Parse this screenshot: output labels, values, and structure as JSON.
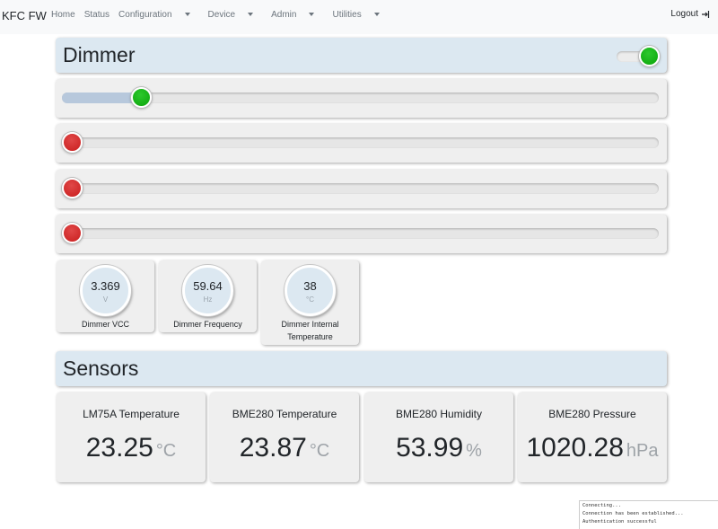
{
  "navbar": {
    "brand": "KFC FW",
    "links": [
      {
        "label": "Home"
      },
      {
        "label": "Status"
      },
      {
        "label": "Configuration"
      },
      {
        "label": "Device"
      },
      {
        "label": "Admin"
      },
      {
        "label": "Utilities"
      }
    ],
    "logout_label": "Logout"
  },
  "dimmer": {
    "title": "Dimmer",
    "enabled": true,
    "channels": [
      {
        "level": 0.12,
        "active": true
      },
      {
        "level": 0.0,
        "active": false
      },
      {
        "level": 0.0,
        "active": false
      },
      {
        "level": 0.0,
        "active": false
      }
    ],
    "gauges": [
      {
        "value": "3.369",
        "unit": "V",
        "label": "Dimmer VCC"
      },
      {
        "value": "59.64",
        "unit": "Hz",
        "label": "Dimmer Frequency"
      },
      {
        "value": "38",
        "unit": "°C",
        "label": "Dimmer Internal Temperature"
      }
    ]
  },
  "sensors": {
    "title": "Sensors",
    "cards": [
      {
        "title": "LM75A Temperature",
        "value": "23.25",
        "unit": "°C"
      },
      {
        "title": "BME280 Temperature",
        "value": "23.87",
        "unit": "°C"
      },
      {
        "title": "BME280 Humidity",
        "value": "53.99",
        "unit": "%"
      },
      {
        "title": "BME280 Pressure",
        "value": "1020.28",
        "unit": "hPa"
      }
    ]
  },
  "console": {
    "lines": [
      "Connecting...",
      "Connection has been established...",
      "Authentication successful"
    ]
  },
  "colors": {
    "header_bg": "#dce8f1",
    "card_bg": "#efefef",
    "knob_on": "#11b311",
    "knob_off": "#d32a2a",
    "slider_fill": "#b7c8dc"
  }
}
